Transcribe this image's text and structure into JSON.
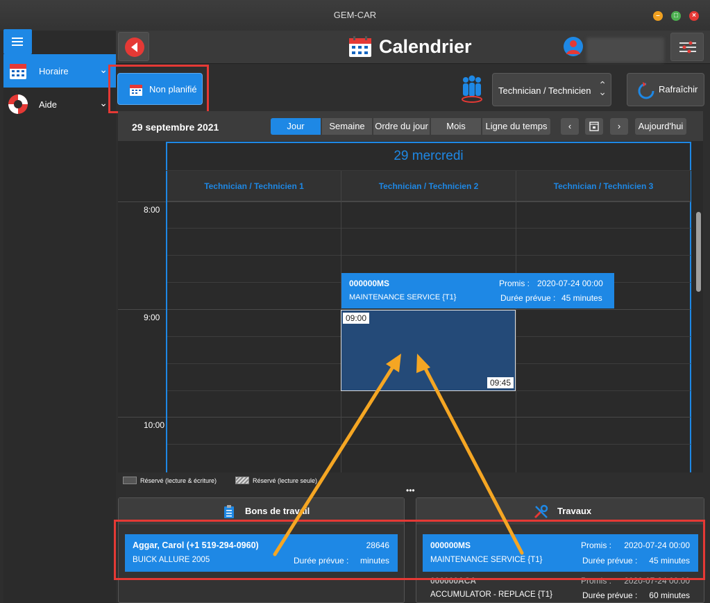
{
  "window": {
    "title": "GEM-CAR"
  },
  "sidebar": {
    "items": [
      {
        "label": "Horaire",
        "icon": "calendar-icon",
        "active": true
      },
      {
        "label": "Aide",
        "icon": "lifebuoy-icon",
        "active": false
      }
    ]
  },
  "header": {
    "title": "Calendrier",
    "user_name": ""
  },
  "toolbar": {
    "nonplan_label": "Non planifié",
    "tech_select_value": "Technician / Technicien",
    "refresh_label": "Rafraîchir"
  },
  "calendar": {
    "date_label": "29 septembre 2021",
    "views": [
      "Jour",
      "Semaine",
      "Ordre du jour",
      "Mois",
      "Ligne du temps"
    ],
    "active_view": "Jour",
    "today_label": "Aujourd'hui",
    "day_title": "29 mercredi",
    "technicians": [
      "Technician / Technicien 1",
      "Technician / Technicien 2",
      "Technician / Technicien 3"
    ],
    "times": [
      "8:00",
      "9:00",
      "10:00"
    ],
    "event": {
      "number": "000000MS",
      "description": "MAINTENANCE SERVICE  {T1}",
      "promise_label": "Promis :",
      "promise_value": "2020-07-24 00:00",
      "duration_label": "Durée prévue :",
      "duration_value": "45 minutes"
    },
    "slot_start": "09:00",
    "slot_end": "09:45"
  },
  "legend": {
    "reserved_rw": "Réservé (lecture & écriture)",
    "reserved_ro": "Réservé (lecture seule)"
  },
  "panels": {
    "work_orders": {
      "title": "Bons de travail",
      "card": {
        "customer": "Aggar, Carol (+1 519-294-0960)",
        "number": "28646",
        "vehicle": "BUICK ALLURE 2005",
        "duration_label": "Durée prévue :",
        "duration_value": "minutes"
      }
    },
    "jobs": {
      "title": "Travaux",
      "card1": {
        "number": "000000MS",
        "promise_label": "Promis :",
        "promise_value": "2020-07-24 00:00",
        "description": "MAINTENANCE SERVICE  {T1}",
        "duration_label": "Durée prévue :",
        "duration_value": "45 minutes"
      },
      "card2": {
        "number": "000000ACA",
        "promise_label": "Promis :",
        "promise_value": "2020-07-24 00:00",
        "description": "ACCUMULATOR - REPLACE {T1}",
        "duration_label": "Durée prévue :",
        "duration_value": "60 minutes"
      }
    }
  },
  "colors": {
    "accent": "#1e88e5",
    "highlight": "#e53935",
    "arrow": "#f5a623"
  }
}
